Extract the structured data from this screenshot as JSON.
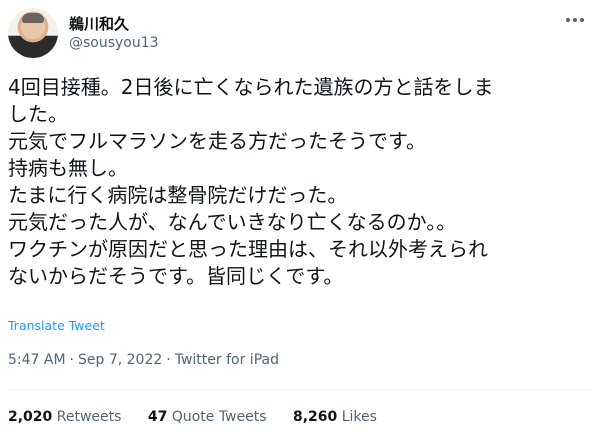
{
  "author": {
    "name": "鵜川和久",
    "handle": "@sousyou13"
  },
  "tweet": {
    "lines": [
      "4回目接種。2日後に亡くなられた遺族の方と話をしま",
      "した。",
      "元気でフルマラソンを走る方だったそうです。",
      "持病も無し。",
      "たまに行く病院は整骨院だけだった。",
      "元気だった人が、なんでいきなり亡くなるのか。。",
      "ワクチンが原因だと思った理由は、それ以外考えられ",
      "ないからだそうです。皆同じくです。"
    ],
    "translate_label": "Translate Tweet"
  },
  "meta": {
    "time": "5:47 AM",
    "date": "Sep 7, 2022",
    "separator": "·",
    "source": "Twitter for iPad"
  },
  "stats": {
    "retweets_count": "2,020",
    "retweets_label": "Retweets",
    "quotes_count": "47",
    "quotes_label": "Quote Tweets",
    "likes_count": "8,260",
    "likes_label": "Likes"
  },
  "icons": {
    "more": "more-options-icon"
  }
}
